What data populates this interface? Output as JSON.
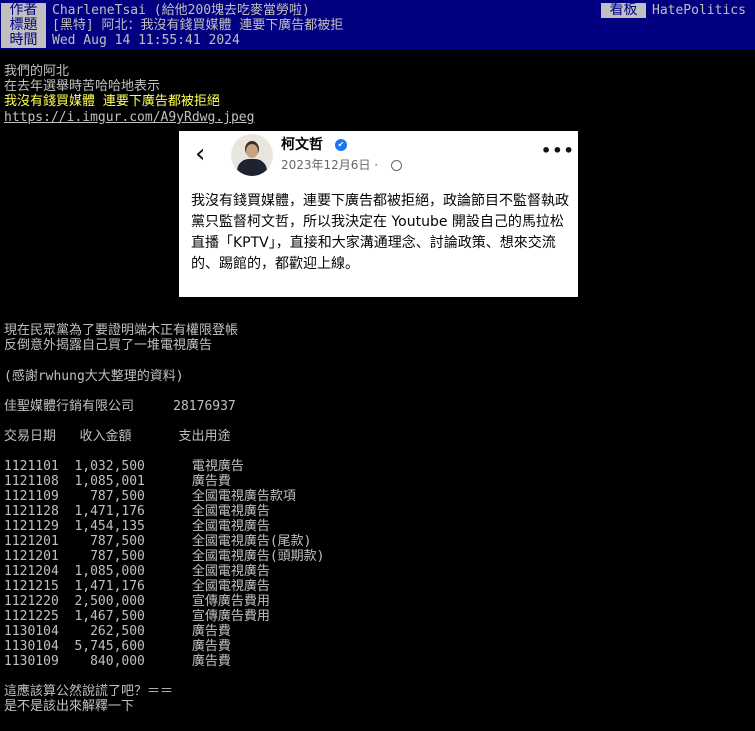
{
  "header": {
    "author_label": "作者",
    "author_value": "CharleneTsai (給他200塊去吃麥當勞啦)",
    "title_label": "標題",
    "title_value": "[黑特] 阿北：我沒有錢買媒體 連要下廣告都被拒",
    "time_label": "時間",
    "time_value": "Wed Aug 14 11:55:41 2024",
    "board_label": "看板",
    "board_name": "HatePolitics"
  },
  "post": {
    "intro_lines": [
      "我們的阿北",
      "在去年選舉時苦哈哈地表示"
    ],
    "highlight": "我沒有錢買媒體 連要下廣告都被拒絕",
    "link": "https://i.imgur.com/A9yRdwg.jpeg",
    "para1": [
      "現在民眾黨為了要證明端木正有權限登帳",
      "反倒意外揭露自己買了一堆電視廣告"
    ],
    "thanks": "(感謝rwhung大大整理的資料)",
    "company": "佳聖媒體行銷有限公司     28176937",
    "table_header": "交易日期   收入金額      支出用途",
    "table_rows": [
      "1121101  1,032,500      電視廣告",
      "1121108  1,085,001      廣告費",
      "1121109    787,500      全國電視廣告款項",
      "1121128  1,471,176      全國電視廣告",
      "1121129  1,454,135      全國電視廣告",
      "1121201    787,500      全國電視廣告(尾款)",
      "1121201    787,500      全國電視廣告(頭期款)",
      "1121204  1,085,000      全國電視廣告",
      "1121215  1,471,176      全國電視廣告",
      "1121220  2,500,000      宣傳廣告費用",
      "1121225  1,467,500      宣傳廣告費用",
      "1130104    262,500      廣告費",
      "1130104  5,745,600      廣告費",
      "1130109    840,000      廣告費"
    ],
    "ending": [
      "這應該算公然說謊了吧？＝＝",
      "是不是該出來解釋一下"
    ]
  },
  "facebook": {
    "name": "柯文哲",
    "date": "2023年12月6日 ·",
    "text": "我沒有錢買媒體，連要下廣告都被拒絕，政論節目不監督執政黨只監督柯文哲，所以我決定在 Youtube 開設自己的馬拉松直播「KPTV」，直接和大家溝通理念、討論政策、想來交流的、踢館的，都歡迎上線。",
    "verified_icon": "✔",
    "more_icon": "•••",
    "back_icon": "‹"
  }
}
